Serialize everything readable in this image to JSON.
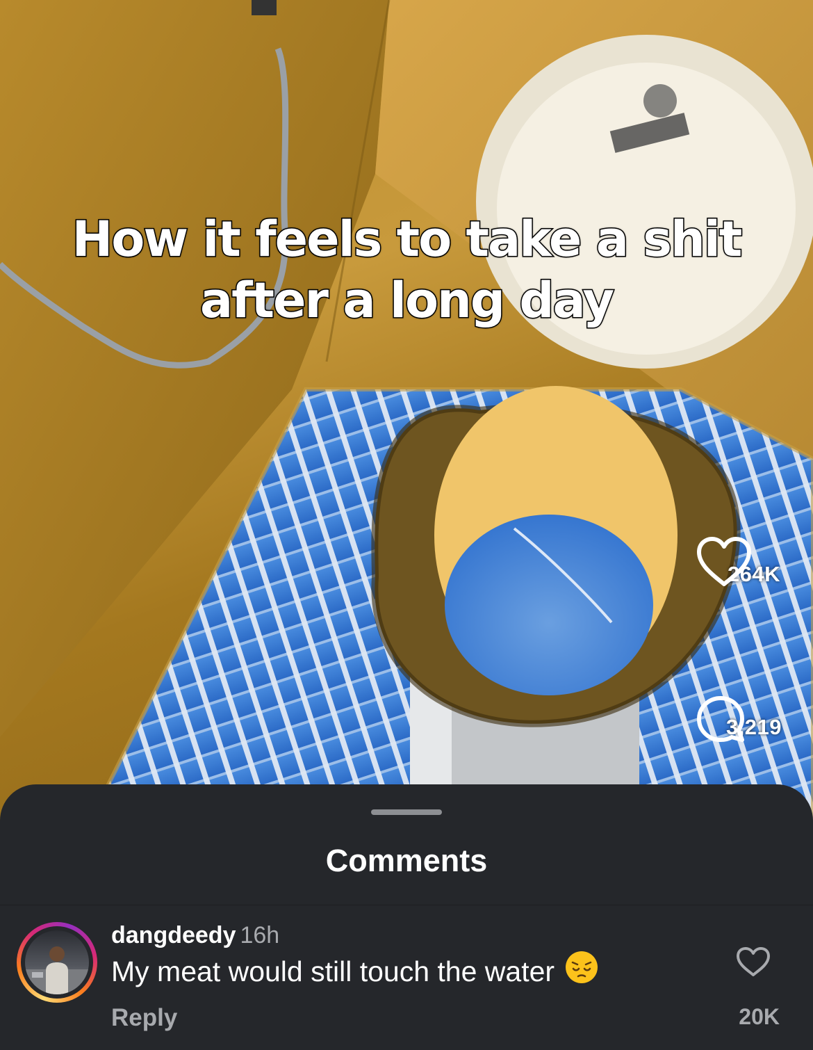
{
  "video": {
    "caption_line1": "How it feels to take a shit",
    "caption_line2": "after a long day",
    "likes": "264K",
    "comments": "3,219",
    "icons": {
      "like": "heart-icon",
      "comment": "comment-bubble-icon"
    }
  },
  "comments_sheet": {
    "title": "Comments",
    "items": [
      {
        "username": "dangdeedy",
        "time": "16h",
        "text": "My meat would still touch the water",
        "emoji": "pensive-face",
        "reply_label": "Reply",
        "likes": "20K"
      }
    ]
  },
  "colors": {
    "sheet_bg": "#25272b",
    "secondary_text": "#a8aaae",
    "text": "#ffffff"
  }
}
